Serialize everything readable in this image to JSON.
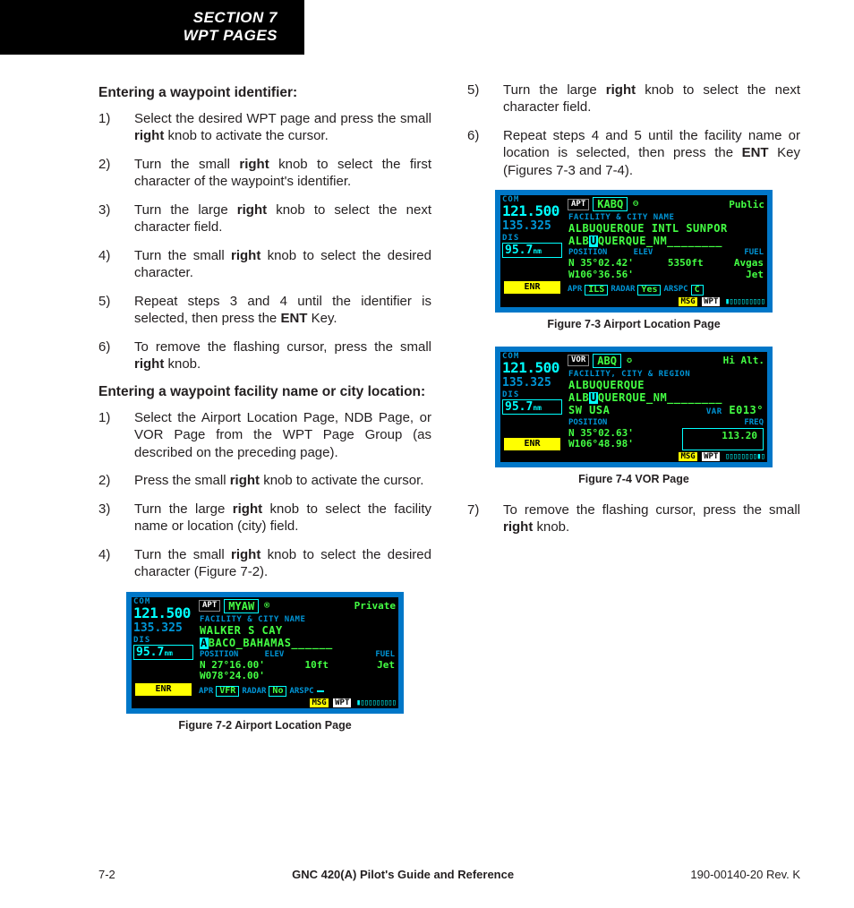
{
  "header": {
    "line1": "SECTION 7",
    "line2": "WPT PAGES"
  },
  "left": {
    "h1": "Entering a waypoint identifier:",
    "steps1": [
      {
        "pre": "Select the desired WPT page and press the small ",
        "b": "right",
        "post": " knob to activate the cursor."
      },
      {
        "pre": "Turn the small ",
        "b": "right",
        "post": " knob to select the first character of the waypoint's identifier."
      },
      {
        "pre": "Turn the large ",
        "b": "right",
        "post": " knob to select the next character field."
      },
      {
        "pre": "Turn the small ",
        "b": "right",
        "post": " knob to select the desired character."
      },
      {
        "pre": "Repeat steps 3 and 4 until the identifier is selected, then press the ",
        "b": "ENT",
        "post": " Key."
      },
      {
        "pre": "To remove the flashing cursor, press the small ",
        "b": "right",
        "post": " knob."
      }
    ],
    "h2": "Entering a waypoint facility name or city location:",
    "steps2": [
      {
        "pre": "Select the Airport Location Page, NDB Page, or VOR Page from the WPT Page Group (as described on the preceding page).",
        "b": "",
        "post": ""
      },
      {
        "pre": "Press the small ",
        "b": "right",
        "post": " knob to activate the cursor."
      },
      {
        "pre": "Turn the large ",
        "b": "right",
        "post": " knob to select the facility name or location (city) field."
      },
      {
        "pre": "Turn the small ",
        "b": "right",
        "post": " knob to select the desired character (Figure 7-2)."
      }
    ],
    "fig2cap": "Figure 7-2  Airport Location Page"
  },
  "right": {
    "steps3": [
      {
        "n": "5",
        "pre": "Turn the large ",
        "b": "right",
        "post": " knob to select the next character field."
      },
      {
        "n": "6",
        "pre": "Repeat steps 4 and 5 until the facility name or location is selected, then press the ",
        "b": "ENT",
        "post": " Key (Figures 7-3 and 7-4)."
      }
    ],
    "fig3cap": "Figure 7-3  Airport Location Page",
    "fig4cap": "Figure 7-4  VOR Page",
    "steps4": [
      {
        "n": "7",
        "pre": "To remove the flashing cursor, press the small ",
        "b": "right",
        "post": " knob."
      }
    ]
  },
  "fig2": {
    "com": "121.500",
    "vloc": "135.325",
    "dis": "95.7",
    "unit": "nm",
    "tag": "APT",
    "ident": "MYAW",
    "sym": "®",
    "type": "Private",
    "sub": "FACILITY & CITY NAME",
    "line1": "WALKER S CAY",
    "cur": "A",
    "line2rest": "BACO_BAHAMAS______",
    "h1": "POSITION",
    "h2": "ELEV",
    "h3": "FUEL",
    "lat": "N 27°16.00'",
    "lon": "W078°24.00'",
    "elev": "10ft",
    "fuel": "Jet",
    "apr": "VFR",
    "radar": "No",
    "arspc": "",
    "enr": "ENR",
    "msg": "MSG",
    "wpt": "WPT"
  },
  "fig3": {
    "com": "121.500",
    "vloc": "135.325",
    "dis": "95.7",
    "unit": "nm",
    "tag": "APT",
    "ident": "KABQ",
    "sym": "⊖",
    "type": "Public",
    "sub": "FACILITY & CITY NAME",
    "line1": "ALBUQUERQUE INTL SUNPOR",
    "line2a": "ALB",
    "cur": "U",
    "line2b": "QUERQUE_NM________",
    "h1": "POSITION",
    "h2": "ELEV",
    "h3": "FUEL",
    "lat": "N 35°02.42'",
    "lon": "W106°36.56'",
    "elev": "5350ft",
    "fuel1": "Avgas",
    "fuel2": "Jet",
    "apr": "ILS",
    "radar": "Yes",
    "arspc": "C",
    "enr": "ENR",
    "msg": "MSG",
    "wpt": "WPT"
  },
  "fig4": {
    "com": "121.500",
    "vloc": "135.325",
    "dis": "95.7",
    "unit": "nm",
    "tag": "VOR",
    "ident": "ABQ",
    "sym": "✪",
    "type": "Hi Alt.",
    "sub": "FACILITY, CITY & REGION",
    "line1": "ALBUQUERQUE",
    "line2a": "ALB",
    "cur": "U",
    "line2b": "QUERQUE_NM________",
    "region": "SW USA",
    "var": "E013°",
    "h1": "POSITION",
    "h2": "FREQ",
    "lat": "N 35°02.63'",
    "lon": "W106°48.98'",
    "freq": "113.20",
    "enr": "ENR",
    "msg": "MSG",
    "wpt": "WPT",
    "varlbl": "VAR"
  },
  "footer": {
    "left": "7-2",
    "mid": "GNC 420(A) Pilot's Guide and Reference",
    "right": "190-00140-20  Rev. K"
  }
}
